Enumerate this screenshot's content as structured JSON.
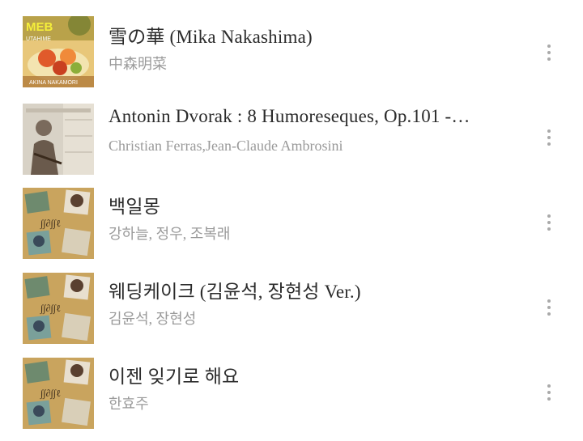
{
  "tracks": [
    {
      "title": "雪の華 (Mika Nakashima)",
      "artist": "中森明菜",
      "art_icon": "album-art-meb"
    },
    {
      "title": "Antonin Dvorak : 8 Humoreseques, Op.101 -…",
      "artist": "Christian Ferras,Jean-Claude Ambrosini",
      "art_icon": "album-art-violinist"
    },
    {
      "title": "백일몽",
      "artist": "강하늘, 정우, 조복래",
      "art_icon": "album-art-korean-ost"
    },
    {
      "title": "웨딩케이크 (김윤석, 장현성 Ver.)",
      "artist": "김윤석, 장현성",
      "art_icon": "album-art-korean-ost"
    },
    {
      "title": "이젠 잊기로 해요",
      "artist": "한효주",
      "art_icon": "album-art-korean-ost"
    }
  ],
  "art_text": {
    "meb_title": "MEB",
    "meb_sub": "AKINA NAKAMORI",
    "meb_side": "UTAHIME"
  },
  "more_icon": "vertical-ellipsis-icon"
}
